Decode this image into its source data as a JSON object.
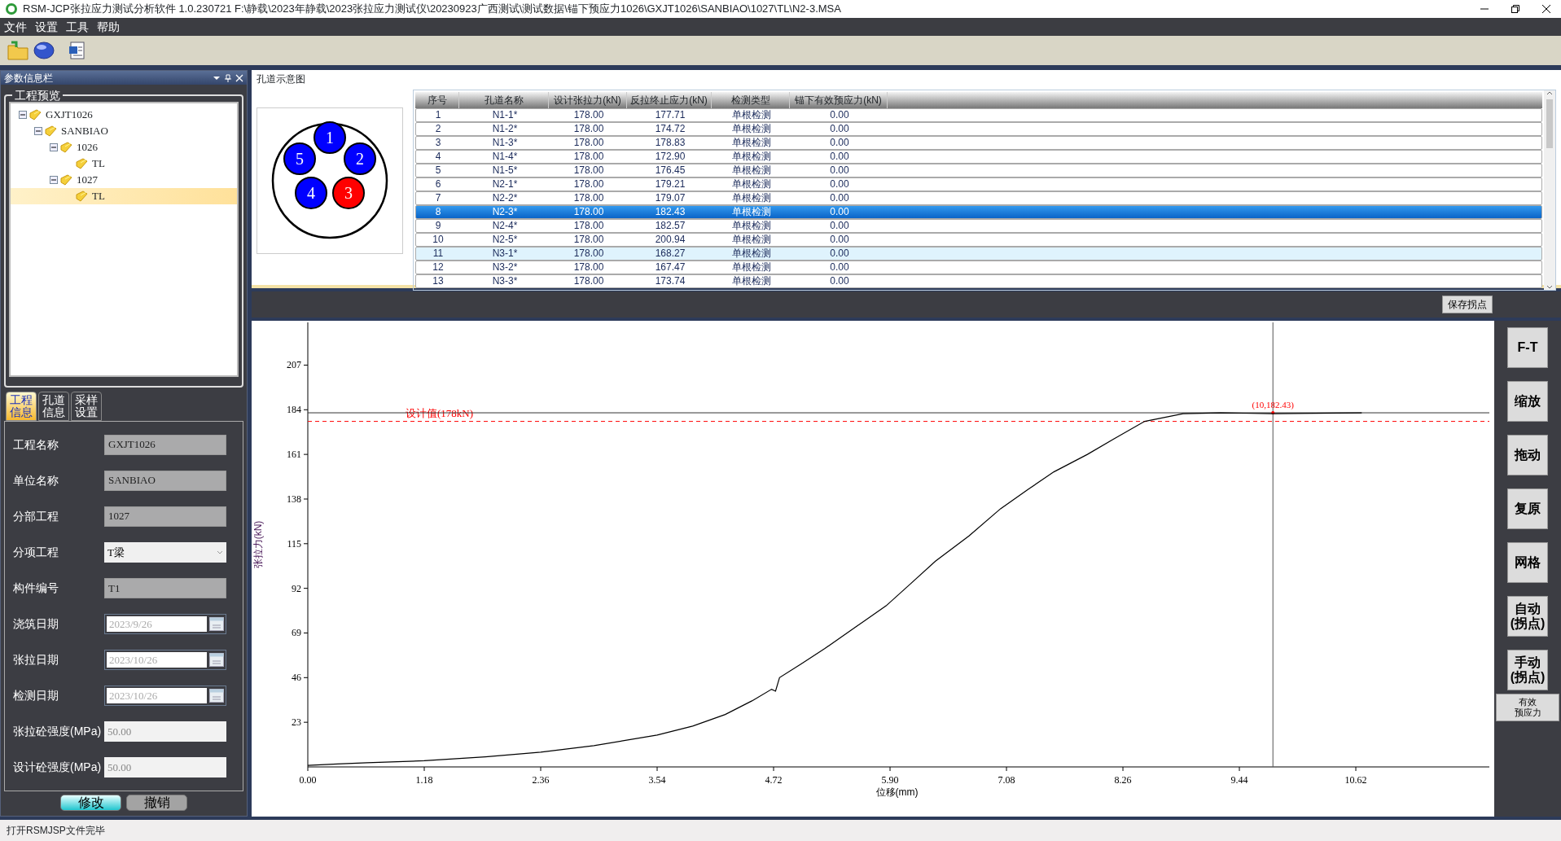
{
  "window": {
    "title": "RSM-JCP张拉应力测试分析软件 1.0.230721  F:\\静载\\2023年静载\\2023张拉应力测试仪\\20230923广西测试\\测试数据\\锚下预应力1026\\GXJT1026\\SANBIAO\\1027\\TL\\N2-3.MSA"
  },
  "menu": [
    "文件",
    "设置",
    "工具",
    "帮助"
  ],
  "side_panel": {
    "title": "参数信息栏",
    "group_title": "工程预览",
    "tree": [
      {
        "label": "GXJT1026",
        "expanded": true,
        "selected": false,
        "children": [
          {
            "label": "SANBIAO",
            "expanded": true,
            "selected": false,
            "children": [
              {
                "label": "1026",
                "expanded": true,
                "selected": false,
                "children": [
                  {
                    "label": "TL",
                    "selected": false
                  }
                ]
              },
              {
                "label": "1027",
                "expanded": true,
                "selected": false,
                "children": [
                  {
                    "label": "TL",
                    "selected": true
                  }
                ]
              }
            ]
          }
        ]
      }
    ],
    "tabs": [
      {
        "label": "工程信息",
        "selected": true
      },
      {
        "label": "孔道信息",
        "selected": false
      },
      {
        "label": "采样设置",
        "selected": false
      }
    ],
    "fields": [
      {
        "label": "工程名称",
        "value": "GXJT1026",
        "kind": "readonly"
      },
      {
        "label": "单位名称",
        "value": "SANBIAO",
        "kind": "readonly"
      },
      {
        "label": "分部工程",
        "value": "1027",
        "kind": "readonly"
      },
      {
        "label": "分项工程",
        "value": "T梁",
        "kind": "select"
      },
      {
        "label": "构件编号",
        "value": "T1",
        "kind": "readonly"
      },
      {
        "label": "浇筑日期",
        "value": "2023/9/26",
        "kind": "date"
      },
      {
        "label": "张拉日期",
        "value": "2023/10/26",
        "kind": "date"
      },
      {
        "label": "检测日期",
        "value": "2023/10/26",
        "kind": "date"
      },
      {
        "label": "张拉砼强度(MPa)",
        "value": "50.00",
        "kind": "input"
      },
      {
        "label": "设计砼强度(MPa)",
        "value": "50.00",
        "kind": "input"
      }
    ],
    "buttons": [
      {
        "label": "修改",
        "kind": "primary"
      },
      {
        "label": "撤销",
        "kind": "secondary"
      }
    ]
  },
  "diagram": {
    "title": "孔道示意图",
    "holes": [
      {
        "label": "1",
        "color": "#0000ff"
      },
      {
        "label": "2",
        "color": "#0000ff"
      },
      {
        "label": "3",
        "color": "#ff0000"
      },
      {
        "label": "4",
        "color": "#0000ff"
      },
      {
        "label": "5",
        "color": "#0000ff"
      }
    ]
  },
  "table": {
    "columns": [
      "序号",
      "孔道名称",
      "设计张拉力(kN)",
      "反拉终止应力(kN)",
      "检测类型",
      "锚下有效预应力(kN)"
    ],
    "rows": [
      {
        "cells": [
          "1",
          "N1-1*",
          "178.00",
          "177.71",
          "单根检测",
          "0.00"
        ],
        "selected": false,
        "hovered": false
      },
      {
        "cells": [
          "2",
          "N1-2*",
          "178.00",
          "174.72",
          "单根检测",
          "0.00"
        ],
        "selected": false,
        "hovered": false
      },
      {
        "cells": [
          "3",
          "N1-3*",
          "178.00",
          "178.83",
          "单根检测",
          "0.00"
        ],
        "selected": false,
        "hovered": false
      },
      {
        "cells": [
          "4",
          "N1-4*",
          "178.00",
          "172.90",
          "单根检测",
          "0.00"
        ],
        "selected": false,
        "hovered": false
      },
      {
        "cells": [
          "5",
          "N1-5*",
          "178.00",
          "176.45",
          "单根检测",
          "0.00"
        ],
        "selected": false,
        "hovered": false
      },
      {
        "cells": [
          "6",
          "N2-1*",
          "178.00",
          "179.21",
          "单根检测",
          "0.00"
        ],
        "selected": false,
        "hovered": false
      },
      {
        "cells": [
          "7",
          "N2-2*",
          "178.00",
          "179.07",
          "单根检测",
          "0.00"
        ],
        "selected": false,
        "hovered": false
      },
      {
        "cells": [
          "8",
          "N2-3*",
          "178.00",
          "182.43",
          "单根检测",
          "0.00"
        ],
        "selected": true,
        "hovered": false
      },
      {
        "cells": [
          "9",
          "N2-4*",
          "178.00",
          "182.57",
          "单根检测",
          "0.00"
        ],
        "selected": false,
        "hovered": false
      },
      {
        "cells": [
          "10",
          "N2-5*",
          "178.00",
          "200.94",
          "单根检测",
          "0.00"
        ],
        "selected": false,
        "hovered": false
      },
      {
        "cells": [
          "11",
          "N3-1*",
          "178.00",
          "168.27",
          "单根检测",
          "0.00"
        ],
        "selected": false,
        "hovered": true
      },
      {
        "cells": [
          "12",
          "N3-2*",
          "178.00",
          "167.47",
          "单根检测",
          "0.00"
        ],
        "selected": false,
        "hovered": false
      },
      {
        "cells": [
          "13",
          "N3-3*",
          "178.00",
          "173.74",
          "单根检测",
          "0.00"
        ],
        "selected": false,
        "hovered": false
      }
    ]
  },
  "chart_toolbar": {
    "button": "保存拐点"
  },
  "chart": {
    "chart_data": {
      "type": "line",
      "xlabel": "位移(mm)",
      "ylabel": "张拉力(kN)",
      "x": [
        0,
        0.3,
        0.6,
        1.18,
        1.8,
        2.36,
        2.9,
        3.54,
        3.9,
        4.23,
        4.5,
        4.7,
        4.74,
        4.78,
        5.0,
        5.24,
        5.55,
        5.86,
        6.1,
        6.36,
        6.7,
        7.02,
        7.3,
        7.56,
        7.9,
        8.17,
        8.48,
        8.87,
        9.25,
        9.79,
        10.2,
        10.68
      ],
      "series": [
        {
          "color": "#000000",
          "values": [
            0.8,
            1.5,
            2.2,
            3.2,
            5.2,
            7.6,
            11,
            16.4,
            21,
            27,
            34,
            40,
            39,
            46,
            53,
            61,
            72,
            83,
            94,
            106,
            119,
            133,
            143,
            152,
            161,
            169,
            178,
            182,
            182.4,
            182,
            182.2,
            182.4
          ]
        }
      ],
      "xlim": [
        0,
        11.94
      ],
      "ylim": [
        0,
        229
      ],
      "xticks": [
        {
          "value": 0,
          "label": "0.00"
        },
        {
          "value": 1.18,
          "label": "1.18"
        },
        {
          "value": 2.36,
          "label": "2.36"
        },
        {
          "value": 3.54,
          "label": "3.54"
        },
        {
          "value": 4.72,
          "label": "4.72"
        },
        {
          "value": 5.9,
          "label": "5.90"
        },
        {
          "value": 7.08,
          "label": "7.08"
        },
        {
          "value": 8.26,
          "label": "8.26"
        },
        {
          "value": 9.44,
          "label": "9.44"
        },
        {
          "value": 10.62,
          "label": "10.62"
        }
      ],
      "yticks": [
        23,
        46,
        69,
        92,
        115,
        138,
        161,
        184,
        207
      ],
      "ref_lines": [
        {
          "axis": "y",
          "value": 178,
          "label": "设计值(178kN)"
        },
        {
          "axis": "y",
          "value": 182.43
        },
        {
          "axis": "x",
          "value": 9.78
        }
      ],
      "annotations": [
        "(10,182.43)"
      ]
    }
  },
  "tool_buttons": [
    {
      "label": "F-T",
      "kind": "large"
    },
    {
      "label": "缩放",
      "kind": "large"
    },
    {
      "label": "拖动",
      "kind": "large"
    },
    {
      "label": "复原",
      "kind": "large"
    },
    {
      "label": "网格",
      "kind": "large"
    },
    {
      "label": "自动\n(拐点)",
      "kind": "large"
    },
    {
      "label": "手动\n(拐点)",
      "kind": "large"
    },
    {
      "lines": [
        "有效",
        "预应力"
      ],
      "kind": "small"
    }
  ],
  "status_bar": "打开RSMJSP文件完毕"
}
